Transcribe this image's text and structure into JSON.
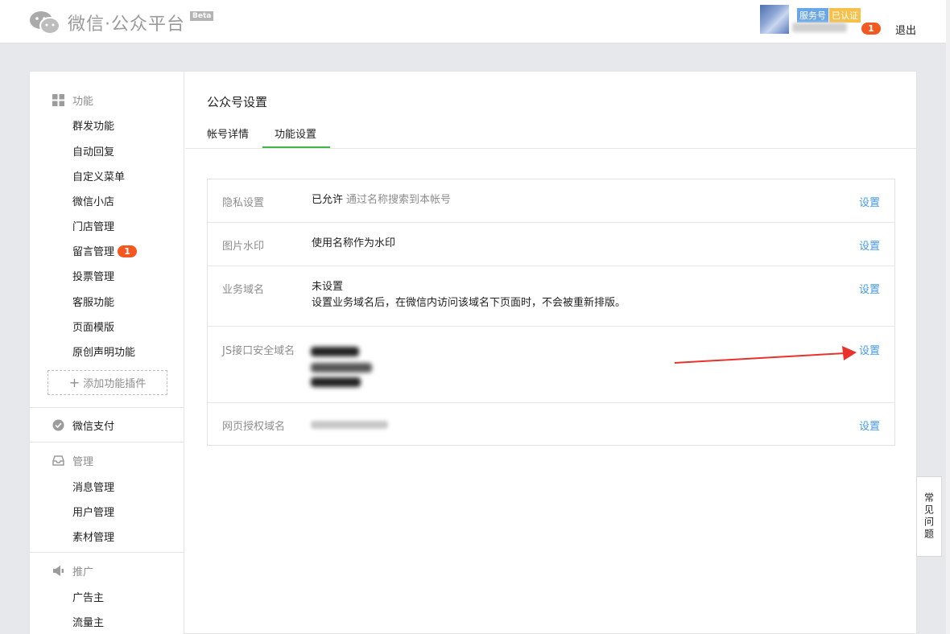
{
  "header": {
    "brand": "微信·公众平台",
    "beta": "Beta",
    "badge_service": "服务号",
    "badge_verified": "已认证",
    "notify_count": "1",
    "logout": "退出"
  },
  "sidebar": {
    "sec_function": "功能",
    "function_items": [
      "群发功能",
      "自动回复",
      "自定义菜单",
      "微信小店",
      "门店管理",
      "留言管理",
      "投票管理",
      "客服功能",
      "页面模版",
      "原创声明功能"
    ],
    "message_badge": "1",
    "add_plugin": "添加功能插件",
    "sec_pay": "微信支付",
    "sec_manage": "管理",
    "manage_items": [
      "消息管理",
      "用户管理",
      "素材管理"
    ],
    "sec_promote": "推广",
    "promote_items": [
      "广告主",
      "流量主"
    ]
  },
  "content": {
    "title": "公众号设置",
    "tabs": [
      "帐号详情",
      "功能设置"
    ],
    "rows": [
      {
        "label": "隐私设置",
        "value": "已允许",
        "sub": "通过名称搜索到本帐号",
        "link": "设置"
      },
      {
        "label": "图片水印",
        "value": "使用名称作为水印",
        "link": "设置"
      },
      {
        "label": "业务域名",
        "value": "未设置",
        "value2": "设置业务域名后，在微信内访问该域名下页面时，不会被重新排版。",
        "link": "设置"
      },
      {
        "label": "JS接口安全域名",
        "link": "设置"
      },
      {
        "label": "网页授权域名",
        "link": "设置"
      }
    ]
  },
  "faq": "常见问题",
  "colors": {
    "accent_green": "#44b549",
    "link_blue": "#459ae9",
    "badge_red": "#f2581f",
    "arrow_red": "#e8322b"
  }
}
